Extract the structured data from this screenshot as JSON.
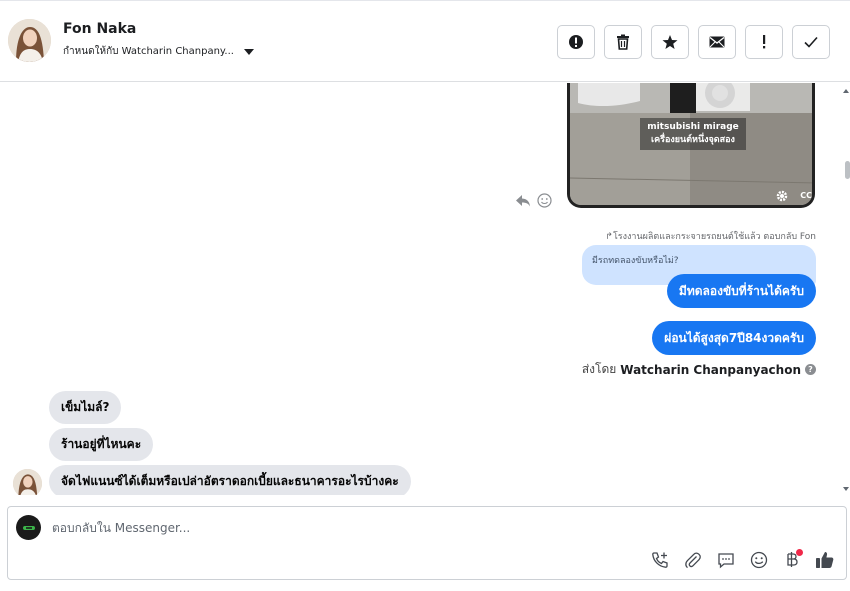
{
  "header": {
    "contact_name": "Fon Naka",
    "assigned_to": "กำหนดให้กับ Watcharin Chanpany...",
    "actions": [
      {
        "name": "spam-button",
        "icon": "alert-circle-icon"
      },
      {
        "name": "delete-button",
        "icon": "trash-icon"
      },
      {
        "name": "star-button",
        "icon": "star-icon"
      },
      {
        "name": "mark-unread-button",
        "icon": "envelope-icon"
      },
      {
        "name": "follow-up-button",
        "icon": "exclamation-icon"
      },
      {
        "name": "done-button",
        "icon": "checkmark-icon"
      }
    ]
  },
  "conversation": {
    "video_caption_line1": "mitsubishi mirage",
    "video_caption_line2": "เครื่องยนต์หนึ่งจุดสอง",
    "reply_context": "โรงงานผลิตและกระจายรถยนต์ใช้แล้ว ตอบกลับ Fon",
    "quoted_message": "มีรถทดลองขับหรือไม่?",
    "outgoing": [
      "มีทดลองขับที่ร้านได้ครับ",
      "ผ่อนได้สูงสุด7ปี84งวดครับ"
    ],
    "sent_by_prefix": "ส่งโดย",
    "sent_by_name": "Watcharin Chanpanyachon",
    "incoming": [
      "เข็มไมล์?",
      "ร้านอยู่ที่ไหนคะ",
      "จัดไฟแนนซ์ได้เต็มหรือเปล่าอัตราดอกเบี้ยและธนาคารอะไรบ้างคะ"
    ]
  },
  "composer": {
    "placeholder": "ตอบกลับใน Messenger..."
  },
  "colors": {
    "accent": "#1877f2",
    "incoming_bubble": "#e4e6eb",
    "quoted_bubble": "#cfe3ff",
    "notification_dot": "#f02849"
  }
}
